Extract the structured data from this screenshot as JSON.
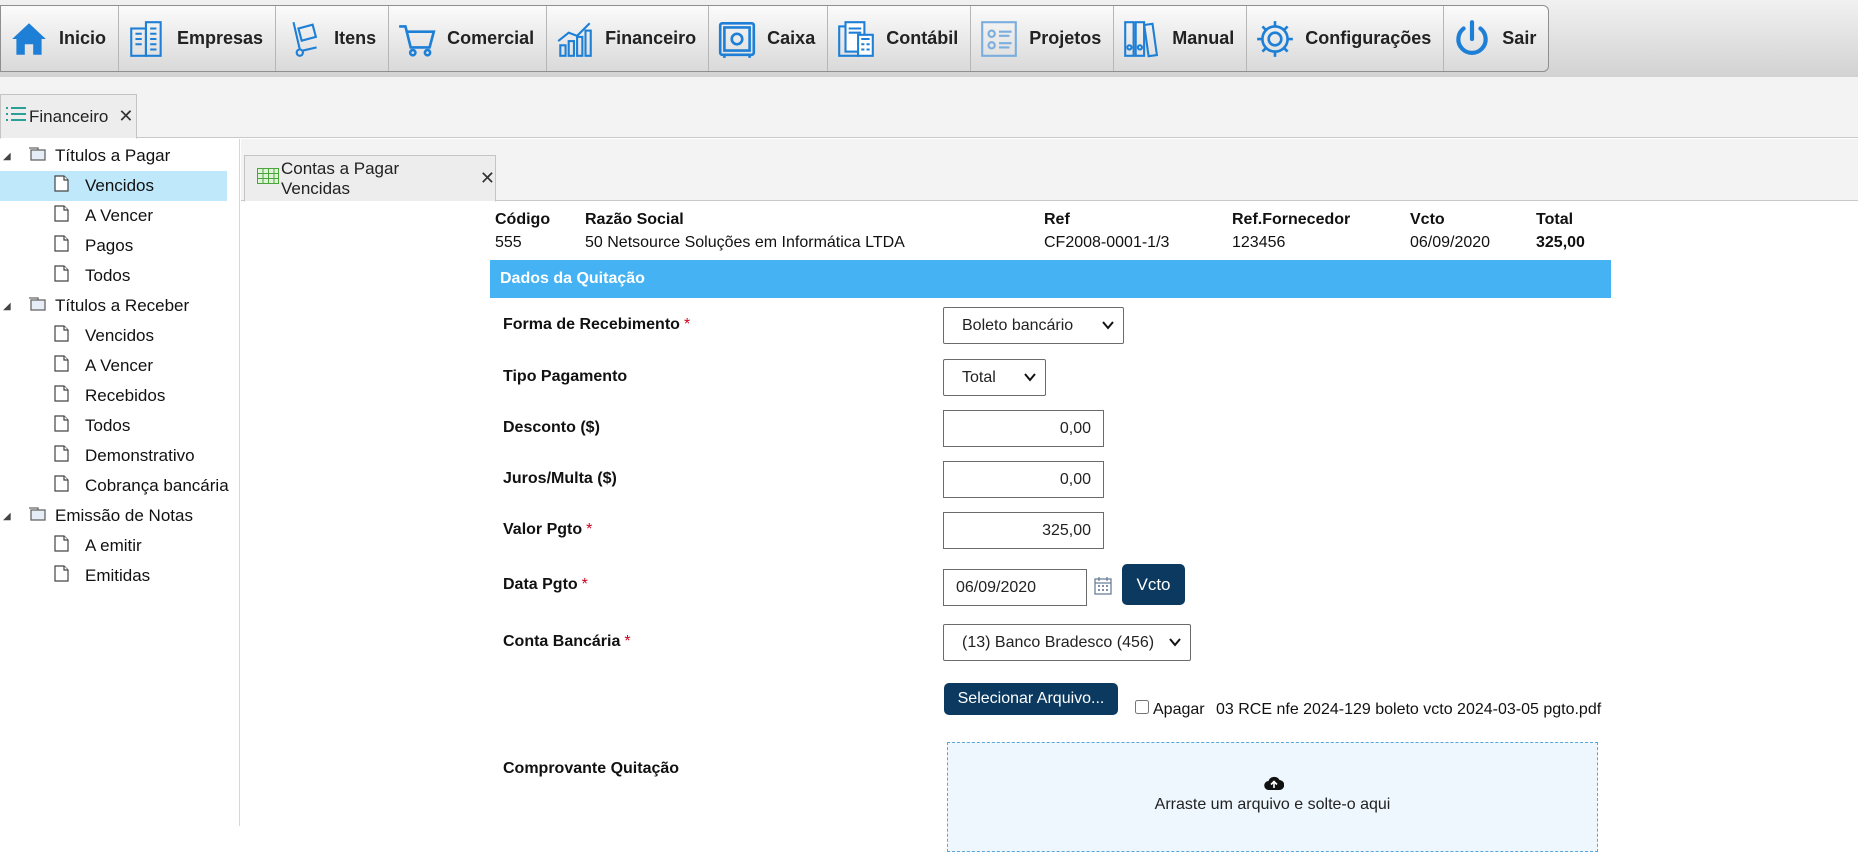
{
  "menu": {
    "items": [
      {
        "label": "Inicio",
        "icon": "home-icon"
      },
      {
        "label": "Empresas",
        "icon": "buildings-icon"
      },
      {
        "label": "Itens",
        "icon": "hand-truck-icon"
      },
      {
        "label": "Comercial",
        "icon": "shopping-cart-icon"
      },
      {
        "label": "Financeiro",
        "icon": "growth-chart-icon"
      },
      {
        "label": "Caixa",
        "icon": "safe-icon"
      },
      {
        "label": "Contábil",
        "icon": "accounting-documents-icon"
      },
      {
        "label": "Projetos",
        "icon": "project-board-icon"
      },
      {
        "label": "Manual",
        "icon": "binders-icon"
      },
      {
        "label": "Configurações",
        "icon": "gear-icon"
      },
      {
        "label": "Sair",
        "icon": "power-icon"
      }
    ]
  },
  "module_tab": {
    "label": "Financeiro",
    "close": "✕"
  },
  "tree": {
    "pagar": {
      "label": "Títulos a Pagar",
      "items": [
        "Vencidos",
        "A Vencer",
        "Pagos",
        "Todos"
      ]
    },
    "receber": {
      "label": "Títulos a Receber",
      "items": [
        "Vencidos",
        "A Vencer",
        "Recebidos",
        "Todos",
        "Demonstrativo",
        "Cobrança bancária"
      ]
    },
    "notas": {
      "label": "Emissão de Notas",
      "items": [
        "A emitir",
        "Emitidas"
      ]
    },
    "selected": "Vencidos"
  },
  "sub_tab": {
    "label": "Contas a Pagar Vencidas",
    "close": "✕"
  },
  "summary": {
    "headers": {
      "codigo": "Código",
      "razao": "Razão Social",
      "ref": "Ref",
      "ref_forn": "Ref.Fornecedor",
      "vcto": "Vcto",
      "total": "Total"
    },
    "values": {
      "codigo": "555",
      "razao": "50 Netsource Soluções em Informática LTDA",
      "ref": "CF2008-0001-1/3",
      "ref_forn": "123456",
      "vcto": "06/09/2020",
      "total": "325,00"
    }
  },
  "section": {
    "title": "Dados da Quitação"
  },
  "form": {
    "forma": {
      "label": "Forma de Recebimento",
      "value": "Boleto bancário"
    },
    "tipo": {
      "label": "Tipo Pagamento",
      "value": "Total"
    },
    "desconto": {
      "label": "Desconto ($)",
      "value": "0,00"
    },
    "juros": {
      "label": "Juros/Multa ($)",
      "value": "0,00"
    },
    "valor": {
      "label": "Valor Pgto",
      "value": "325,00"
    },
    "data": {
      "label": "Data Pgto",
      "value": "06/09/2020",
      "vcto_button": "Vcto"
    },
    "conta": {
      "label": "Conta Bancária",
      "value": "(13) Banco Bradesco (456)"
    },
    "arquivo": {
      "button": "Selecionar Arquivo...",
      "delete_label": "Apagar",
      "filename": "03 RCE nfe 2024-129 boleto vcto 2024-03-05 pgto.pdf",
      "delete_checked": false
    },
    "comprovante": {
      "label": "Comprovante Quitação",
      "dropzone_text": "Arraste um arquivo e solte-o aqui"
    },
    "required_mark": "*"
  },
  "colors": {
    "section_bar": "#45b3f3",
    "dark_button": "#0b3960",
    "selected_row": "#bfe8fb",
    "menu_icon_blue": "#1e7fd6"
  }
}
